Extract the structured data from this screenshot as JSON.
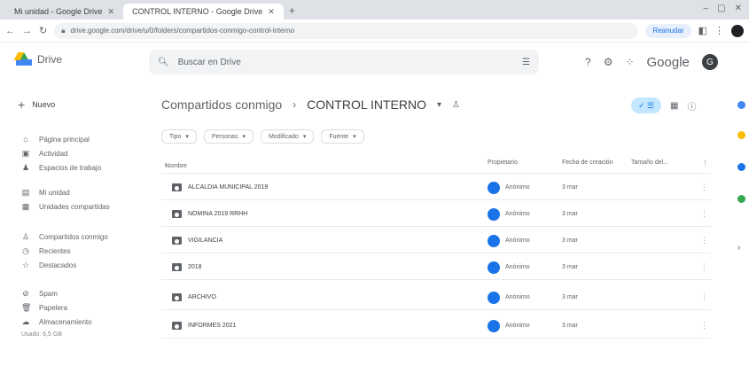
{
  "browser": {
    "tabs": [
      {
        "label": "Mi unidad - Google Drive"
      },
      {
        "label": "CONTROL INTERNO - Google Drive"
      }
    ],
    "url": "drive.google.com/drive/u/0/folders/compartidos-conmigo-control-interno",
    "ext_label": "Reanudar"
  },
  "drive": {
    "app_name": "Drive",
    "search_placeholder": "Buscar en Drive",
    "google_word": "Google",
    "avatar_letter": "G"
  },
  "sidebar": {
    "new_label": "Nuevo",
    "items": [
      {
        "label": "Página principal",
        "icon": "home-icon"
      },
      {
        "label": "Actividad",
        "icon": "activity-icon"
      },
      {
        "label": "Espacios de trabajo",
        "icon": "workspaces-icon"
      },
      {
        "label": "Mi unidad",
        "icon": "drive-icon"
      },
      {
        "label": "Unidades compartidas",
        "icon": "shared-drives-icon"
      },
      {
        "label": "Compartidos conmigo",
        "icon": "shared-with-me-icon"
      },
      {
        "label": "Recientes",
        "icon": "clock-icon"
      },
      {
        "label": "Destacados",
        "icon": "star-icon"
      },
      {
        "label": "Spam",
        "icon": "spam-icon"
      },
      {
        "label": "Papelera",
        "icon": "trash-icon"
      },
      {
        "label": "Almacenamiento",
        "icon": "cloud-icon"
      }
    ],
    "storage_text": "Usado: 6,5 GB"
  },
  "main": {
    "breadcrumb_root": "Compartidos conmigo",
    "breadcrumb_current": "CONTROL INTERNO",
    "chips": [
      "Tipo",
      "Personas",
      "Modificado",
      "Fuente"
    ],
    "columns": {
      "name": "Nombre",
      "owner": "Propietario",
      "date": "Fecha de creación",
      "size": "Tamaño del..."
    },
    "rows": [
      {
        "name": "ALCALDIA MUNICIPAL 2019",
        "owner": "Anónimo",
        "date": "3 mar"
      },
      {
        "name": "NOMINA 2019 RRHH",
        "owner": "Anónimo",
        "date": "3 mar"
      },
      {
        "name": "VIGILANCIA",
        "owner": "Anónimo",
        "date": "3 mar"
      },
      {
        "name": "2018",
        "owner": "Anónimo",
        "date": "3 mar"
      },
      {
        "name": "ARCHIVO",
        "owner": "Anónimo",
        "date": "3 mar"
      },
      {
        "name": "INFORMES 2021",
        "owner": "Anónimo",
        "date": "3 mar"
      }
    ]
  },
  "colors": {
    "accent": "#1a73e8",
    "toggle_bg": "#c2e7ff",
    "owner_avatar": "#1a73e8",
    "rail": [
      "#4285f4",
      "#fbbc04",
      "#1a73e8",
      "#34a853"
    ]
  }
}
